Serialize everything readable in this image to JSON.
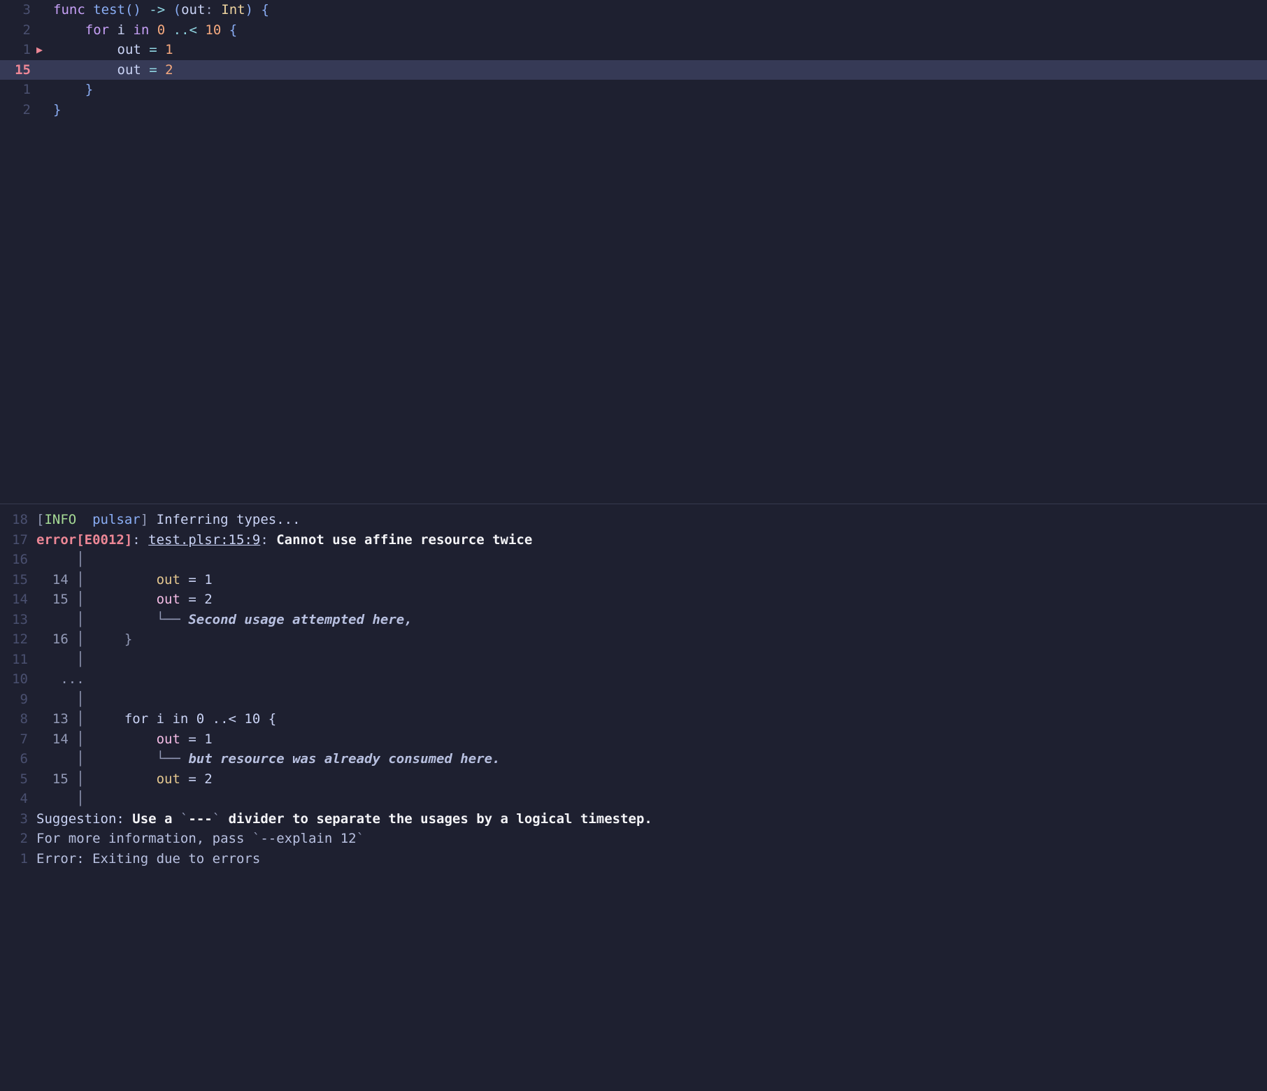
{
  "editor": {
    "lines": [
      {
        "gutter": "3",
        "current": false,
        "marker": "",
        "highlighted": false,
        "tokens": [
          {
            "t": "func ",
            "c": "kw"
          },
          {
            "t": "test",
            "c": "fn"
          },
          {
            "t": "() ",
            "c": "punct"
          },
          {
            "t": "-> ",
            "c": "op"
          },
          {
            "t": "(",
            "c": "punct"
          },
          {
            "t": "out",
            "c": "ident"
          },
          {
            "t": ": ",
            "c": "softpunct"
          },
          {
            "t": "Int",
            "c": "type"
          },
          {
            "t": ") {",
            "c": "punct"
          }
        ]
      },
      {
        "gutter": "2",
        "current": false,
        "marker": "",
        "highlighted": false,
        "tokens": [
          {
            "t": "    ",
            "c": ""
          },
          {
            "t": "for ",
            "c": "kw"
          },
          {
            "t": "i ",
            "c": "ident"
          },
          {
            "t": "in ",
            "c": "kw"
          },
          {
            "t": "0 ",
            "c": "num"
          },
          {
            "t": "..< ",
            "c": "op"
          },
          {
            "t": "10 ",
            "c": "num"
          },
          {
            "t": "{",
            "c": "punct"
          }
        ]
      },
      {
        "gutter": "1",
        "current": false,
        "marker": "▶",
        "highlighted": false,
        "tokens": [
          {
            "t": "        ",
            "c": ""
          },
          {
            "t": "out ",
            "c": "ident"
          },
          {
            "t": "= ",
            "c": "op"
          },
          {
            "t": "1",
            "c": "num"
          }
        ]
      },
      {
        "gutter": "15",
        "current": true,
        "marker": "",
        "highlighted": true,
        "tokens": [
          {
            "t": "        ",
            "c": ""
          },
          {
            "t": "out ",
            "c": "ident"
          },
          {
            "t": "= ",
            "c": "op"
          },
          {
            "t": "2",
            "c": "num"
          }
        ]
      },
      {
        "gutter": "1",
        "current": false,
        "marker": "",
        "highlighted": false,
        "tokens": [
          {
            "t": "    ",
            "c": ""
          },
          {
            "t": "}",
            "c": "punct"
          }
        ]
      },
      {
        "gutter": "2",
        "current": false,
        "marker": "",
        "highlighted": false,
        "tokens": [
          {
            "t": "}",
            "c": "punct"
          }
        ]
      }
    ]
  },
  "terminal": {
    "lines": [
      {
        "g": "18",
        "segs": [
          {
            "t": "[",
            "c": "info-bracket"
          },
          {
            "t": "INFO",
            "c": "info-tag"
          },
          {
            "t": "  ",
            "c": ""
          },
          {
            "t": "pulsar",
            "c": "info-source"
          },
          {
            "t": "] ",
            "c": "info-bracket"
          },
          {
            "t": "Inferring types...",
            "c": "info-msg"
          }
        ]
      },
      {
        "g": "17",
        "segs": [
          {
            "t": "error[E0012]",
            "c": "err-tag"
          },
          {
            "t": ": ",
            "c": "dim"
          },
          {
            "t": "test.plsr:15:9",
            "c": "err-loc"
          },
          {
            "t": ": ",
            "c": "dim"
          },
          {
            "t": "Cannot use affine resource twice",
            "c": "err-msg"
          }
        ]
      },
      {
        "g": "16",
        "segs": [
          {
            "t": "     │",
            "c": "pipe"
          }
        ]
      },
      {
        "g": "15",
        "segs": [
          {
            "t": "  14 │         ",
            "c": "pipe"
          },
          {
            "t": "out",
            "c": "tok-out"
          },
          {
            "t": " = 1",
            "c": "ident"
          }
        ]
      },
      {
        "g": "14",
        "segs": [
          {
            "t": "  15 │         ",
            "c": "pipe"
          },
          {
            "t": "out",
            "c": "tok-outpink"
          },
          {
            "t": " = 2",
            "c": "ident"
          }
        ]
      },
      {
        "g": "13",
        "segs": [
          {
            "t": "     │         ",
            "c": "pipe"
          },
          {
            "t": "└── ",
            "c": "arrow"
          },
          {
            "t": "Second usage attempted here,",
            "c": "annot"
          }
        ]
      },
      {
        "g": "12",
        "segs": [
          {
            "t": "  16 │     }",
            "c": "pipe"
          }
        ]
      },
      {
        "g": "11",
        "segs": [
          {
            "t": "     │",
            "c": "pipe"
          }
        ]
      },
      {
        "g": "10",
        "segs": [
          {
            "t": "   ...",
            "c": "pipe"
          }
        ]
      },
      {
        "g": "9",
        "segs": [
          {
            "t": "     │",
            "c": "pipe"
          }
        ]
      },
      {
        "g": "8",
        "segs": [
          {
            "t": "  13 │     ",
            "c": "pipe"
          },
          {
            "t": "for i in 0 ..< 10 {",
            "c": "ident"
          }
        ]
      },
      {
        "g": "7",
        "segs": [
          {
            "t": "  14 │         ",
            "c": "pipe"
          },
          {
            "t": "out",
            "c": "tok-outpink"
          },
          {
            "t": " = 1",
            "c": "ident"
          }
        ]
      },
      {
        "g": "6",
        "segs": [
          {
            "t": "     │         ",
            "c": "pipe"
          },
          {
            "t": "└── ",
            "c": "arrow"
          },
          {
            "t": "but resource was already consumed here.",
            "c": "annot"
          }
        ]
      },
      {
        "g": "5",
        "segs": [
          {
            "t": "  15 │         ",
            "c": "pipe"
          },
          {
            "t": "out",
            "c": "tok-out"
          },
          {
            "t": " = 2",
            "c": "ident"
          }
        ]
      },
      {
        "g": "4",
        "segs": [
          {
            "t": "     │",
            "c": "pipe"
          }
        ]
      },
      {
        "g": "3",
        "segs": [
          {
            "t": "Suggestion: ",
            "c": "sugg-label"
          },
          {
            "t": "Use a ",
            "c": "sugg-text"
          },
          {
            "t": "`",
            "c": "backtick"
          },
          {
            "t": "---",
            "c": "sugg-text"
          },
          {
            "t": "`",
            "c": "backtick"
          },
          {
            "t": " divider to separate the usages by a logical timestep.",
            "c": "sugg-text"
          }
        ]
      },
      {
        "g": "2",
        "segs": [
          {
            "t": "For more information, pass ",
            "c": "dim"
          },
          {
            "t": "`",
            "c": "backtick"
          },
          {
            "t": "--explain 12",
            "c": "dim"
          },
          {
            "t": "`",
            "c": "backtick"
          }
        ]
      },
      {
        "g": "1",
        "segs": [
          {
            "t": "Error: Exiting due to errors",
            "c": "dim"
          }
        ]
      }
    ]
  }
}
